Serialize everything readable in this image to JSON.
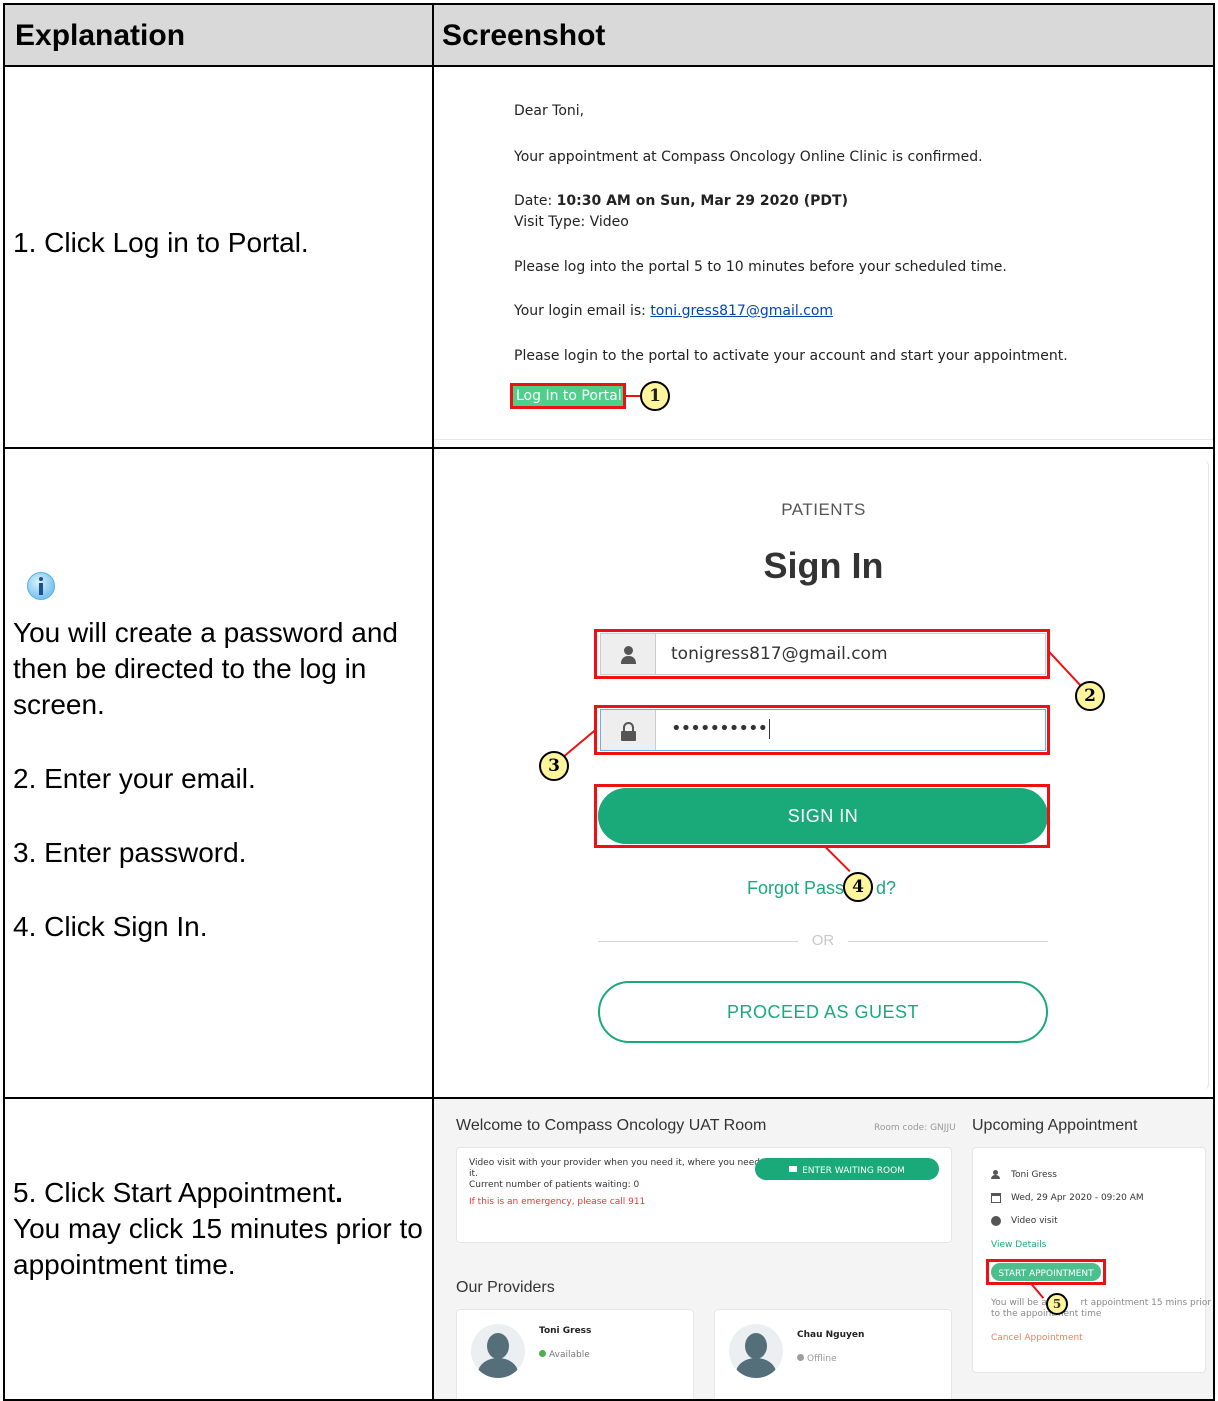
{
  "table": {
    "header_explanation": "Explanation",
    "header_screenshot": "Screenshot"
  },
  "row1": {
    "instruction": "1. Click Log in to Portal.",
    "email": {
      "greeting": "Dear Toni,",
      "confirmation": "Your appointment at Compass Oncology Online Clinic is confirmed.",
      "date_label": "Date: ",
      "date_value": "10:30 AM on Sun, Mar 29 2020 (PDT)",
      "visit_type": "Visit Type: Video",
      "login_hint": "Please log into the portal 5 to 10 minutes before your scheduled time.",
      "login_email_label": "Your login email is: ",
      "login_email": "toni.gress817@gmail.com",
      "activate_hint": "Please login to the portal to activate your account and start your appointment.",
      "portal_button": "Log In to Portal",
      "callout": "1"
    }
  },
  "row2": {
    "info_icon": "info-icon",
    "note": "You will create a password and then be directed to the log in screen.",
    "step2": "2. Enter your email.",
    "step3": "3. Enter password.",
    "step4": "4. Click Sign In.",
    "signin": {
      "eyebrow": "PATIENTS",
      "title": "Sign In",
      "email_value": "tonigress817@gmail.com",
      "password_value": "••••••••••",
      "button": "SIGN IN",
      "forgot_left": "Forgot Pass",
      "forgot_right": "d?",
      "or": "OR",
      "guest_button": "PROCEED AS GUEST",
      "callout2": "2",
      "callout3": "3",
      "callout4": "4",
      "accent": "#1aaa7a"
    }
  },
  "row3": {
    "instruction_a": "5. Click Start Appointment",
    "instruction_dot": ".",
    "instruction_b": "You may click 15 minutes prior to appointment time.",
    "dashboard": {
      "welcome": "Welcome to Compass Oncology UAT Room",
      "room_code": "Room code: GNJJU",
      "waiting_text_a": "Video visit with your provider when you need it, where you need",
      "waiting_text_b": "it.",
      "patients_waiting": "Current number of patients waiting: 0",
      "emergency": "If this is an emergency, please call 911",
      "enter_waiting_room": "ENTER WAITING ROOM",
      "providers_title": "Our Providers",
      "provider1_name": "Toni Gress",
      "provider1_status": "Available",
      "provider2_name": "Chau Nguyen",
      "provider2_status": "Offline",
      "upcoming_title": "Upcoming Appointment",
      "appt_patient": "Toni Gress",
      "appt_datetime": "Wed, 29 Apr 2020 - 09:20 AM",
      "appt_type": "Video visit",
      "view_details": "View Details",
      "start_appointment": "START APPOINTMENT",
      "start_note_a": "You will be able",
      "start_note_b": "rt appointment 15 mins prior",
      "start_note_c": "to the appointment time",
      "cancel": "Cancel Appointment",
      "callout5": "5"
    }
  }
}
